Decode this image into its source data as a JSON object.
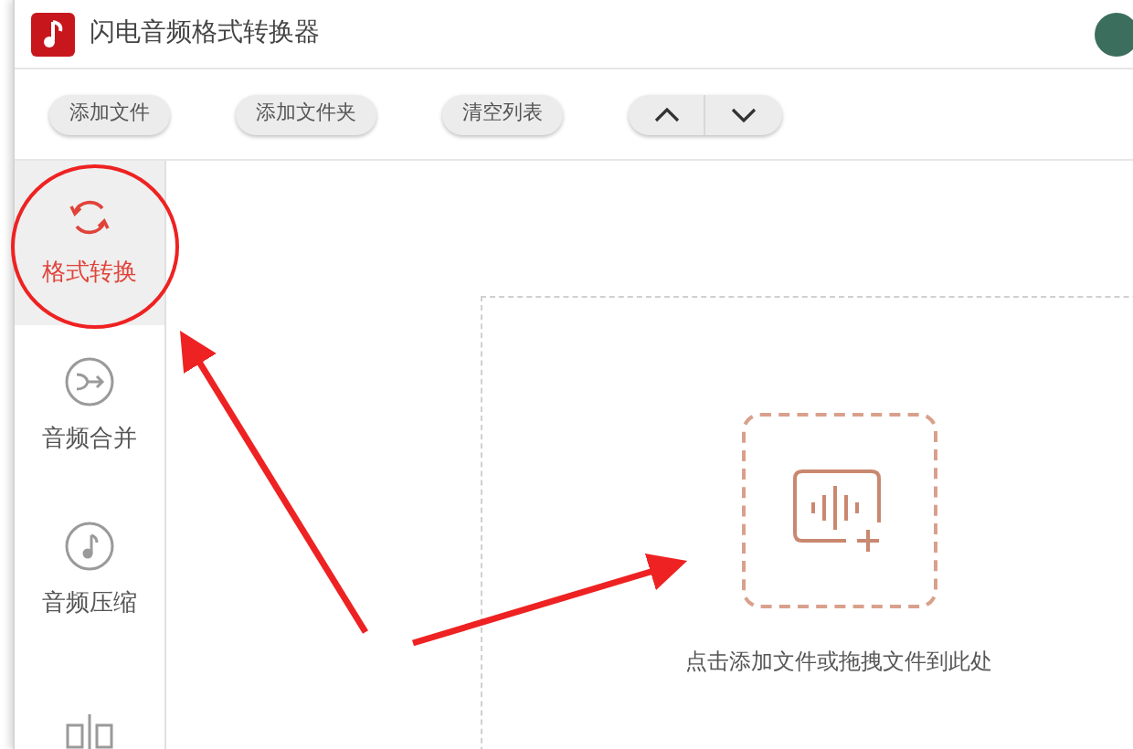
{
  "window": {
    "title": "闪电音频格式转换器"
  },
  "toolbar": {
    "buttons": [
      {
        "label": "添加文件"
      },
      {
        "label": "添加文件夹"
      },
      {
        "label": "清空列表"
      }
    ]
  },
  "sidebar": {
    "items": [
      {
        "kind": "convert",
        "label": "格式转换",
        "selected": true
      },
      {
        "kind": "merge",
        "label": "音频合并",
        "selected": false
      },
      {
        "kind": "compress",
        "label": "音频压缩",
        "selected": false
      },
      {
        "kind": "split",
        "selected": false
      }
    ]
  },
  "drop_area": {
    "hint": "点击添加文件或拖拽文件到此处"
  }
}
